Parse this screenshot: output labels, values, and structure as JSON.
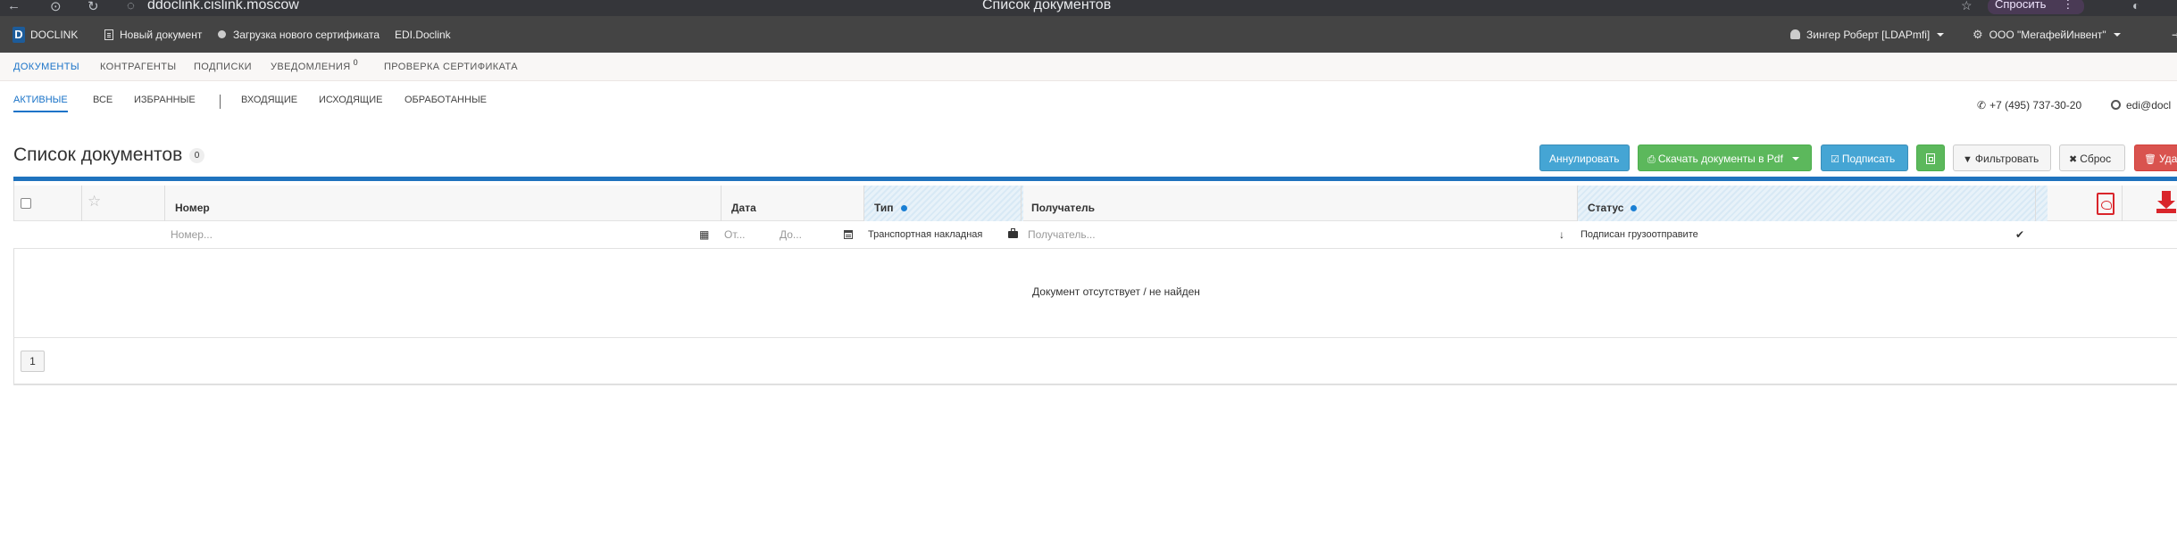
{
  "browser": {
    "url": "ddoclink.cislink.moscow",
    "window_title": "Список документов",
    "ask_button": "Спросить"
  },
  "app_header": {
    "logo_letter": "D",
    "logo_text": "DOCLINK",
    "new_document": "Новый документ",
    "upload_certificate": "Загрузка нового сертификата",
    "edi_link": "EDI.Doclink",
    "user": "Зингер Роберт [LDAPmfi]",
    "organization": "ООО \"МегафейИнвент\""
  },
  "top_nav": {
    "items": [
      "ДОКУМЕНТЫ",
      "КОНТРАГЕНТЫ",
      "ПОДПИСКИ",
      "УВЕДОМЛЕНИЯ",
      "ПРОВЕРКА СЕРТИФИКАТА"
    ],
    "notifications_count": "0"
  },
  "sub_nav": {
    "items": [
      "АКТИВНЫЕ",
      "ВСЕ",
      "ИЗБРАННЫЕ",
      "ВХОДЯЩИЕ",
      "ИСХОДЯЩИЕ",
      "ОБРАБОТАННЫЕ"
    ],
    "phone": "+7 (495) 737-30-20",
    "email": "edi@docl"
  },
  "page": {
    "title": "Список документов",
    "count": "0"
  },
  "toolbar": {
    "annul": "Аннулировать",
    "download_pdf": "Скачать документы в Pdf",
    "sign": "Подписать",
    "filter": "Фильтровать",
    "reset": "Сброс",
    "delete": "Удал"
  },
  "table": {
    "headers": {
      "number": "Номер",
      "date": "Дата",
      "type": "Тип",
      "recipient": "Получатель",
      "status": "Статус"
    },
    "filters": {
      "number_placeholder": "Номер...",
      "date_from_placeholder": "От...",
      "date_to_placeholder": "До...",
      "type_value": "Транспортная накладная",
      "recipient_placeholder": "Получатель...",
      "status_value": "Подписан грузоотправите"
    },
    "empty_message": "Документ отсутствует / не найден"
  },
  "pagination": {
    "current_page": "1"
  },
  "colors": {
    "accent_blue": "#1f73be",
    "header_dark": "#444444",
    "btn_info": "#45a5d4",
    "btn_success": "#5cb85c",
    "btn_danger": "#d9534f",
    "icon_red": "#d9252b"
  }
}
